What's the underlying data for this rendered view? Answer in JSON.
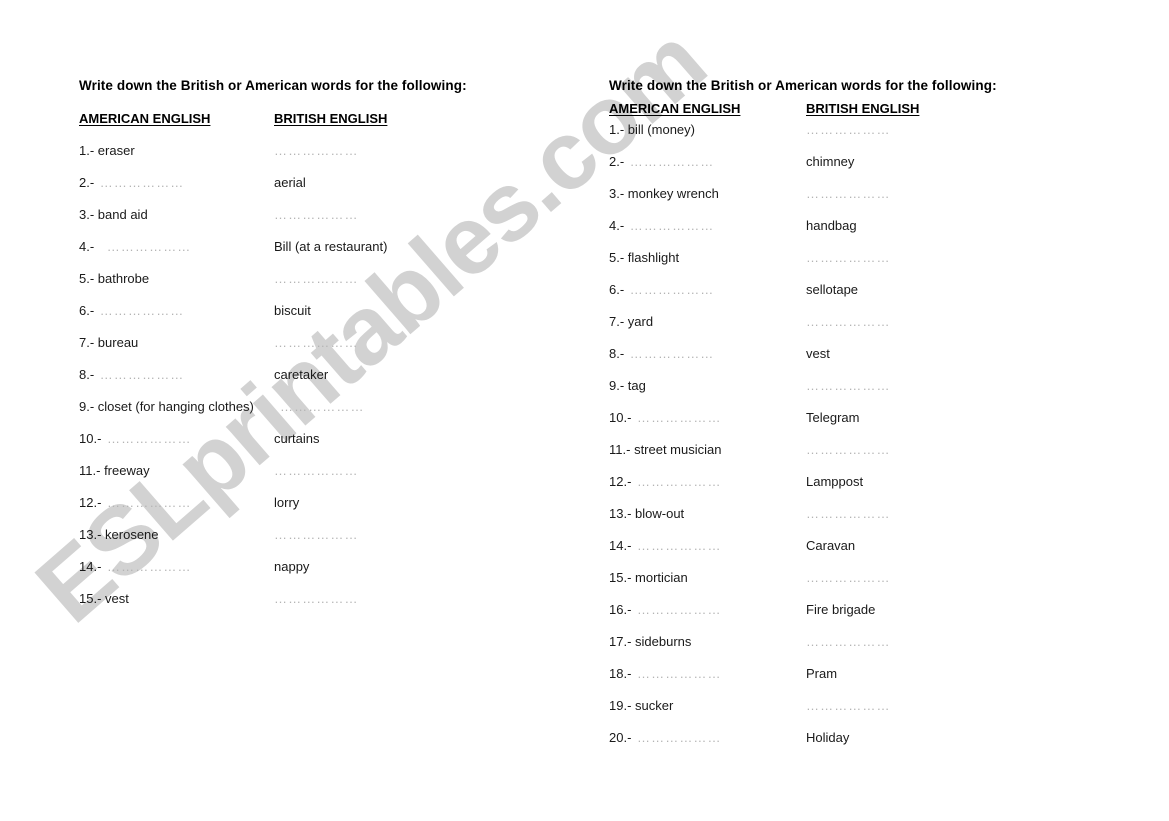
{
  "watermark": {
    "text": "ESLprintables.com",
    "color": "#d2d2d2"
  },
  "blocks": [
    {
      "id": "left",
      "instruction": "Write down the British or American words for the following:",
      "headers": {
        "american": "AMERICAN ENGLISH",
        "british": "BRITISH ENGLISH"
      },
      "blank_text": "………………",
      "rows": [
        {
          "num": "1.-",
          "american": "eraser",
          "british": ""
        },
        {
          "num": "2.-",
          "american": "",
          "british": "aerial"
        },
        {
          "num": "3.-",
          "american": "band aid",
          "british": ""
        },
        {
          "num": "4.-",
          "american": "",
          "british": "Bill (at a restaurant)",
          "pad": true
        },
        {
          "num": "5.-",
          "american": "bathrobe",
          "british": ""
        },
        {
          "num": "6.-",
          "american": "",
          "british": "biscuit"
        },
        {
          "num": "7.-",
          "american": "bureau",
          "british": ""
        },
        {
          "num": "8.-",
          "american": "",
          "british": "caretaker"
        },
        {
          "num": "9.-",
          "american": "closet (for hanging clothes)",
          "british": "",
          "wide": true
        },
        {
          "num": "10.-",
          "american": "",
          "british": "curtains"
        },
        {
          "num": "11.-",
          "american": "freeway",
          "british": ""
        },
        {
          "num": "12.-",
          "american": "",
          "british": "lorry"
        },
        {
          "num": "13.-",
          "american": "kerosene",
          "british": ""
        },
        {
          "num": "14.-",
          "american": "",
          "british": "nappy"
        },
        {
          "num": "15.-",
          "american": "vest",
          "british": ""
        }
      ]
    },
    {
      "id": "right",
      "instruction": "Write down the British or American words for the following:",
      "headers": {
        "american": "AMERICAN ENGLISH",
        "british": "BRITISH ENGLISH"
      },
      "blank_text": "………………",
      "rows": [
        {
          "num": "1.-",
          "american": "bill (money)",
          "british": ""
        },
        {
          "num": "2.-",
          "american": "",
          "british": "chimney"
        },
        {
          "num": "3.-",
          "american": "monkey wrench",
          "british": ""
        },
        {
          "num": "4.-",
          "american": "",
          "british": "handbag"
        },
        {
          "num": "5.-",
          "american": "flashlight",
          "british": ""
        },
        {
          "num": "6.-",
          "american": "",
          "british": "sellotape"
        },
        {
          "num": "7.-",
          "american": "yard",
          "british": ""
        },
        {
          "num": "8.-",
          "american": "",
          "british": "vest"
        },
        {
          "num": "9.-",
          "american": "tag",
          "british": ""
        },
        {
          "num": "10.-",
          "american": "",
          "british": "Telegram"
        },
        {
          "num": "11.-",
          "american": "street musician",
          "british": ""
        },
        {
          "num": "12.-",
          "american": "",
          "british": "Lamppost"
        },
        {
          "num": "13.-",
          "american": "blow-out",
          "british": ""
        },
        {
          "num": "14.-",
          "american": "",
          "british": "Caravan"
        },
        {
          "num": "15.-",
          "american": "mortician",
          "british": ""
        },
        {
          "num": "16.-",
          "american": "",
          "british": "Fire brigade"
        },
        {
          "num": "17.-",
          "american": "sideburns",
          "british": ""
        },
        {
          "num": "18.-",
          "american": "",
          "british": "Pram"
        },
        {
          "num": "19.-",
          "american": "sucker",
          "british": ""
        },
        {
          "num": "20.-",
          "american": "",
          "british": "Holiday"
        }
      ]
    }
  ]
}
